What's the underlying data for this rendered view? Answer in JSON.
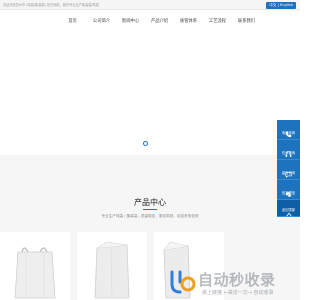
{
  "topbar": {
    "notice": "欢迎光临苏州市 (吨袋/集装袋) 官方网站，我们专业生产集装袋/吨袋",
    "lang_label": "中文 | English"
  },
  "nav": {
    "items": [
      "首页",
      "公司简介",
      "新闻中心",
      "产品介绍",
      "质管体系",
      "工艺流程",
      "联系我们"
    ]
  },
  "products": {
    "title": "产品中心",
    "subtitle": "专业生产吨袋 / 集装袋，质量稳定、服务周到，欢迎来电咨询"
  },
  "sidebar": {
    "items": [
      {
        "label": "电话咨询",
        "icon": "phone-icon"
      },
      {
        "label": "在线咨询",
        "icon": "headset-icon"
      },
      {
        "label": "留言咨询",
        "icon": "chat-icon"
      },
      {
        "label": "官方微信",
        "icon": "wechat-icon"
      },
      {
        "label": "返回顶部",
        "icon": "arrow-up-icon"
      }
    ]
  },
  "watermark": {
    "big": "自动秒收录",
    "small": "做上链接 ←来访一次→ 自动收录"
  },
  "colors": {
    "accent": "#1e73be",
    "sidebar_dark": "#0f5ea8"
  }
}
